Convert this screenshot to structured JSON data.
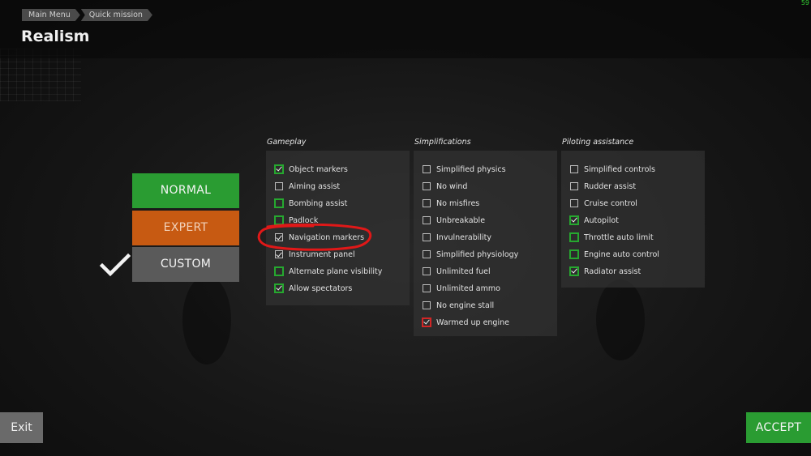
{
  "header": {
    "breadcrumb": [
      "Main Menu",
      "Quick mission"
    ],
    "title": "Realism",
    "fps": "59"
  },
  "presets": {
    "normal": "NORMAL",
    "expert": "EXPERT",
    "custom": "CUSTOM",
    "selected": "CUSTOM"
  },
  "columns": {
    "gameplay": {
      "title": "Gameplay",
      "options": [
        {
          "label": "Object markers",
          "checked": true,
          "highlight": "green"
        },
        {
          "label": "Aiming assist",
          "checked": false,
          "highlight": "none"
        },
        {
          "label": "Bombing assist",
          "checked": false,
          "highlight": "green"
        },
        {
          "label": "Padlock",
          "checked": false,
          "highlight": "green"
        },
        {
          "label": "Navigation markers",
          "checked": true,
          "highlight": "none"
        },
        {
          "label": "Instrument panel",
          "checked": true,
          "highlight": "none"
        },
        {
          "label": "Alternate plane visibility",
          "checked": false,
          "highlight": "green"
        },
        {
          "label": "Allow spectators",
          "checked": true,
          "highlight": "green"
        }
      ]
    },
    "simplifications": {
      "title": "Simplifications",
      "options": [
        {
          "label": "Simplified physics",
          "checked": false,
          "highlight": "none"
        },
        {
          "label": "No wind",
          "checked": false,
          "highlight": "none"
        },
        {
          "label": "No misfires",
          "checked": false,
          "highlight": "none"
        },
        {
          "label": "Unbreakable",
          "checked": false,
          "highlight": "none"
        },
        {
          "label": "Invulnerability",
          "checked": false,
          "highlight": "none"
        },
        {
          "label": "Simplified physiology",
          "checked": false,
          "highlight": "none"
        },
        {
          "label": "Unlimited fuel",
          "checked": false,
          "highlight": "none"
        },
        {
          "label": "Unlimited ammo",
          "checked": false,
          "highlight": "none"
        },
        {
          "label": "No engine stall",
          "checked": false,
          "highlight": "none"
        },
        {
          "label": "Warmed up engine",
          "checked": true,
          "highlight": "red"
        }
      ]
    },
    "piloting": {
      "title": "Piloting assistance",
      "options": [
        {
          "label": "Simplified controls",
          "checked": false,
          "highlight": "none"
        },
        {
          "label": "Rudder assist",
          "checked": false,
          "highlight": "none"
        },
        {
          "label": "Cruise control",
          "checked": false,
          "highlight": "none"
        },
        {
          "label": "Autopilot",
          "checked": true,
          "highlight": "green"
        },
        {
          "label": "Throttle auto limit",
          "checked": false,
          "highlight": "green"
        },
        {
          "label": "Engine auto control",
          "checked": false,
          "highlight": "green"
        },
        {
          "label": "Radiator assist",
          "checked": true,
          "highlight": "green"
        }
      ]
    }
  },
  "footer": {
    "exit": "Exit",
    "accept": "ACCEPT"
  },
  "colors": {
    "green": "#2a9c32",
    "orange": "#c75a12",
    "highlight_green": "#26a82f",
    "highlight_red": "#d22626",
    "annotation": "#e01818"
  }
}
